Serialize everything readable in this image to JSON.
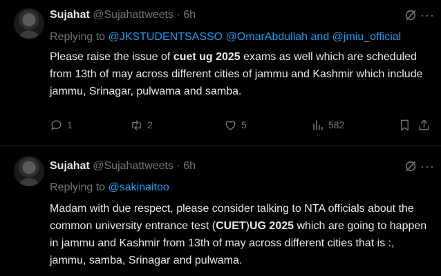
{
  "tweets": [
    {
      "name": "Sujahat",
      "handle": "@Sujahattweets",
      "separator": "·",
      "time": "6h",
      "replying_label": "Replying to ",
      "mentions": [
        "@JKSTUDENTSASSO",
        "@OmarAbdullah",
        "@jmiu_official"
      ],
      "mention_joiner": " and ",
      "body_parts": {
        "p1": "Please raise the issue of ",
        "b1": "cuet ug 2025",
        "p2": " exams as well which are scheduled from 13th of may across different cities of jammu and Kashmir which include jammu, Srinagar, pulwama and samba."
      },
      "stats": {
        "replies": "1",
        "reposts": "2",
        "likes": "5",
        "views": "582"
      }
    },
    {
      "name": "Sujahat",
      "handle": "@Sujahattweets",
      "separator": "·",
      "time": "6h",
      "replying_label": "Replying to ",
      "mentions": [
        "@sakinaitoo"
      ],
      "body_parts": {
        "p1": "Madam with due respect, please consider talking to NTA officials about the common university entrance test (",
        "b1": "CUET",
        "p2": ")",
        "b2": "UG 2025",
        "p3": " which are going to happen in jammu and Kashmir from 13th of may across different cities that is :, jammu, samba, Srinagar and pulwama."
      }
    }
  ],
  "icons": {
    "reply": "reply-icon",
    "repost": "repost-icon",
    "like": "heart-icon",
    "views": "views-icon",
    "bookmark": "bookmark-icon",
    "share": "share-icon",
    "grok": "grok-icon",
    "more": "more-icon"
  },
  "colors": {
    "background": "#000000",
    "text": "#e7e9ea",
    "muted": "#71767b",
    "link": "#1d9bf0",
    "divider": "#2f3336"
  }
}
